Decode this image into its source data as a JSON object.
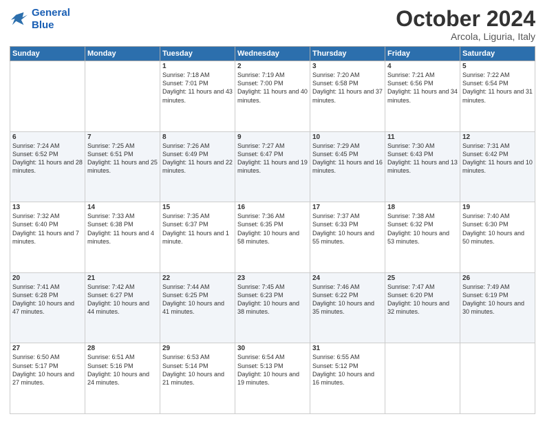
{
  "logo": {
    "line1": "General",
    "line2": "Blue"
  },
  "header": {
    "month": "October 2024",
    "location": "Arcola, Liguria, Italy"
  },
  "weekdays": [
    "Sunday",
    "Monday",
    "Tuesday",
    "Wednesday",
    "Thursday",
    "Friday",
    "Saturday"
  ],
  "weeks": [
    [
      null,
      null,
      {
        "day": 1,
        "sunrise": "7:18 AM",
        "sunset": "7:01 PM",
        "daylight": "11 hours and 43 minutes."
      },
      {
        "day": 2,
        "sunrise": "7:19 AM",
        "sunset": "7:00 PM",
        "daylight": "11 hours and 40 minutes."
      },
      {
        "day": 3,
        "sunrise": "7:20 AM",
        "sunset": "6:58 PM",
        "daylight": "11 hours and 37 minutes."
      },
      {
        "day": 4,
        "sunrise": "7:21 AM",
        "sunset": "6:56 PM",
        "daylight": "11 hours and 34 minutes."
      },
      {
        "day": 5,
        "sunrise": "7:22 AM",
        "sunset": "6:54 PM",
        "daylight": "11 hours and 31 minutes."
      }
    ],
    [
      {
        "day": 6,
        "sunrise": "7:24 AM",
        "sunset": "6:52 PM",
        "daylight": "11 hours and 28 minutes."
      },
      {
        "day": 7,
        "sunrise": "7:25 AM",
        "sunset": "6:51 PM",
        "daylight": "11 hours and 25 minutes."
      },
      {
        "day": 8,
        "sunrise": "7:26 AM",
        "sunset": "6:49 PM",
        "daylight": "11 hours and 22 minutes."
      },
      {
        "day": 9,
        "sunrise": "7:27 AM",
        "sunset": "6:47 PM",
        "daylight": "11 hours and 19 minutes."
      },
      {
        "day": 10,
        "sunrise": "7:29 AM",
        "sunset": "6:45 PM",
        "daylight": "11 hours and 16 minutes."
      },
      {
        "day": 11,
        "sunrise": "7:30 AM",
        "sunset": "6:43 PM",
        "daylight": "11 hours and 13 minutes."
      },
      {
        "day": 12,
        "sunrise": "7:31 AM",
        "sunset": "6:42 PM",
        "daylight": "11 hours and 10 minutes."
      }
    ],
    [
      {
        "day": 13,
        "sunrise": "7:32 AM",
        "sunset": "6:40 PM",
        "daylight": "11 hours and 7 minutes."
      },
      {
        "day": 14,
        "sunrise": "7:33 AM",
        "sunset": "6:38 PM",
        "daylight": "11 hours and 4 minutes."
      },
      {
        "day": 15,
        "sunrise": "7:35 AM",
        "sunset": "6:37 PM",
        "daylight": "11 hours and 1 minute."
      },
      {
        "day": 16,
        "sunrise": "7:36 AM",
        "sunset": "6:35 PM",
        "daylight": "10 hours and 58 minutes."
      },
      {
        "day": 17,
        "sunrise": "7:37 AM",
        "sunset": "6:33 PM",
        "daylight": "10 hours and 55 minutes."
      },
      {
        "day": 18,
        "sunrise": "7:38 AM",
        "sunset": "6:32 PM",
        "daylight": "10 hours and 53 minutes."
      },
      {
        "day": 19,
        "sunrise": "7:40 AM",
        "sunset": "6:30 PM",
        "daylight": "10 hours and 50 minutes."
      }
    ],
    [
      {
        "day": 20,
        "sunrise": "7:41 AM",
        "sunset": "6:28 PM",
        "daylight": "10 hours and 47 minutes."
      },
      {
        "day": 21,
        "sunrise": "7:42 AM",
        "sunset": "6:27 PM",
        "daylight": "10 hours and 44 minutes."
      },
      {
        "day": 22,
        "sunrise": "7:44 AM",
        "sunset": "6:25 PM",
        "daylight": "10 hours and 41 minutes."
      },
      {
        "day": 23,
        "sunrise": "7:45 AM",
        "sunset": "6:23 PM",
        "daylight": "10 hours and 38 minutes."
      },
      {
        "day": 24,
        "sunrise": "7:46 AM",
        "sunset": "6:22 PM",
        "daylight": "10 hours and 35 minutes."
      },
      {
        "day": 25,
        "sunrise": "7:47 AM",
        "sunset": "6:20 PM",
        "daylight": "10 hours and 32 minutes."
      },
      {
        "day": 26,
        "sunrise": "7:49 AM",
        "sunset": "6:19 PM",
        "daylight": "10 hours and 30 minutes."
      }
    ],
    [
      {
        "day": 27,
        "sunrise": "6:50 AM",
        "sunset": "5:17 PM",
        "daylight": "10 hours and 27 minutes."
      },
      {
        "day": 28,
        "sunrise": "6:51 AM",
        "sunset": "5:16 PM",
        "daylight": "10 hours and 24 minutes."
      },
      {
        "day": 29,
        "sunrise": "6:53 AM",
        "sunset": "5:14 PM",
        "daylight": "10 hours and 21 minutes."
      },
      {
        "day": 30,
        "sunrise": "6:54 AM",
        "sunset": "5:13 PM",
        "daylight": "10 hours and 19 minutes."
      },
      {
        "day": 31,
        "sunrise": "6:55 AM",
        "sunset": "5:12 PM",
        "daylight": "10 hours and 16 minutes."
      },
      null,
      null
    ]
  ],
  "labels": {
    "sunrise": "Sunrise:",
    "sunset": "Sunset:",
    "daylight": "Daylight:"
  }
}
